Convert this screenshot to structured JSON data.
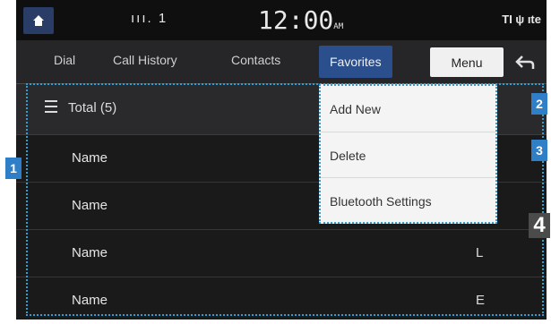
{
  "status_bar": {
    "signal_text": "ııı. 1",
    "clock": "12:00",
    "clock_suffix": "AM",
    "right_icons": "TI ψ ıte"
  },
  "tabs": [
    {
      "label": "Dial"
    },
    {
      "label": "Call History"
    },
    {
      "label": "Contacts"
    },
    {
      "label": "Favorites"
    }
  ],
  "menu_label": "Menu",
  "list": {
    "header": "Total (5)",
    "rows": [
      {
        "name": "Name",
        "phone_glyph": ""
      },
      {
        "name": "Name",
        "phone_glyph": ""
      },
      {
        "name": "Name",
        "phone_glyph": "L"
      },
      {
        "name": "Name",
        "phone_glyph": "E"
      }
    ]
  },
  "dropdown": {
    "items": [
      {
        "label": "Add New"
      },
      {
        "label": "Delete"
      },
      {
        "label": "Bluetooth Settings"
      }
    ]
  },
  "callouts": {
    "left": "1",
    "right_top": "2",
    "right_mid": "3",
    "right_bottom": "4"
  },
  "colors": {
    "active_tab": "#2b4e8c",
    "callout_blue": "#2f7fc8",
    "outline": "#2f9fd8"
  }
}
